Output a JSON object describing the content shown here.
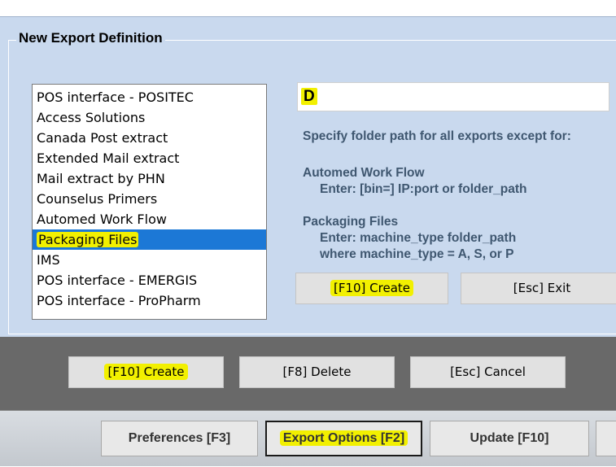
{
  "dialog": {
    "title": "New Export Definition",
    "list_items": [
      {
        "label": "POS interface - POSITEC"
      },
      {
        "label": "Access Solutions"
      },
      {
        "label": "Canada Post extract"
      },
      {
        "label": "Extended Mail extract"
      },
      {
        "label": "Mail extract by PHN"
      },
      {
        "label": "Counselus Primers"
      },
      {
        "label": "Automed Work Flow"
      },
      {
        "label": "Packaging Files",
        "selected": true
      },
      {
        "label": "IMS"
      },
      {
        "label": "POS interface - EMERGIS"
      },
      {
        "label": "POS interface - ProPharm"
      }
    ],
    "path_value": "D",
    "help_text": "Specify folder path for all exports except for:",
    "automed_heading": "Automed Work Flow",
    "automed_enter": "Enter:  [bin=] IP:port or folder_path",
    "packaging_heading": "Packaging Files",
    "packaging_enter": "Enter:  machine_type folder_path",
    "packaging_where": "where machine_type = A, S, or P",
    "inner_create_label": "[F10] Create",
    "inner_exit_label": "[Esc] Exit"
  },
  "action_bar": {
    "create_label": "[F10] Create",
    "delete_label": "[F8] Delete",
    "cancel_label": "[Esc] Cancel"
  },
  "footer": {
    "preferences_label": "Preferences [F3]",
    "export_options_label": "Export Options [F2]",
    "update_label": "Update [F10]"
  },
  "colors": {
    "dialog_bg": "#c9d9ee",
    "selection": "#1c78d6",
    "highlight": "#f2f000",
    "info_text": "#3f5770"
  }
}
